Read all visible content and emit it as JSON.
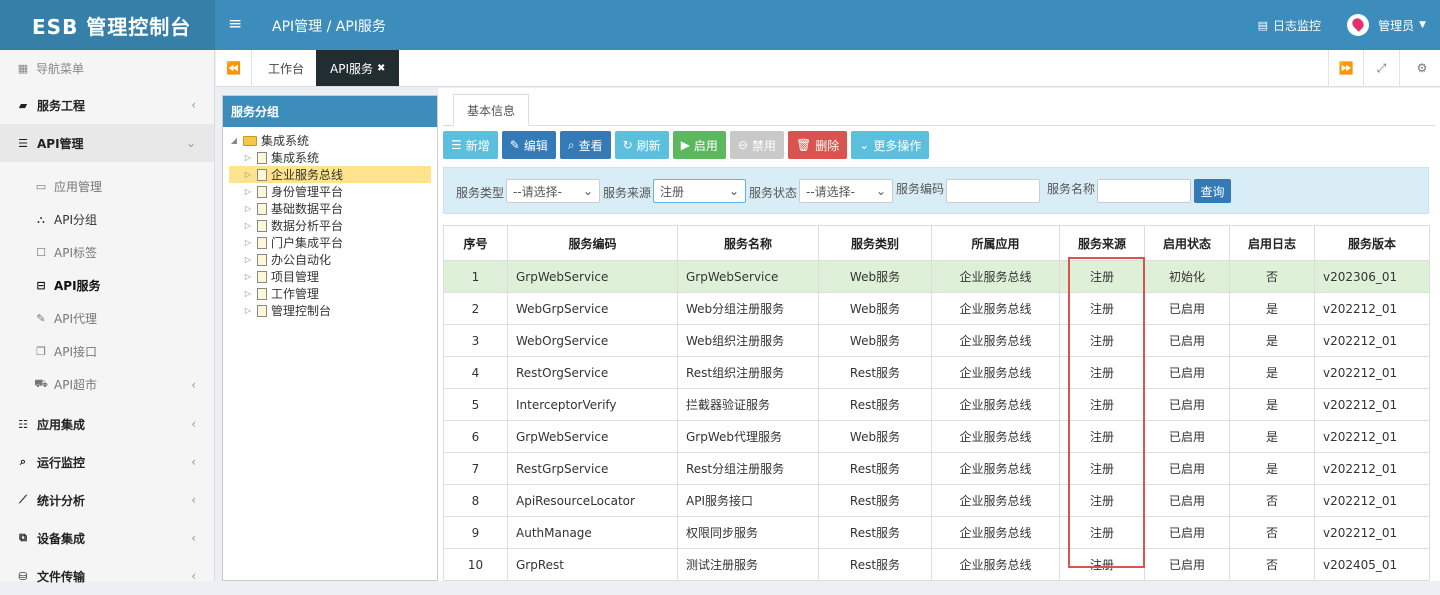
{
  "header": {
    "logo": "ESB 管理控制台",
    "breadcrumb": "API管理 / API服务",
    "log_monitor": "日志监控",
    "user": "管理员"
  },
  "sidebar": {
    "title": "导航菜单",
    "items": [
      {
        "label": "服务工程"
      },
      {
        "label": "API管理"
      }
    ],
    "sub": [
      {
        "label": "应用管理"
      },
      {
        "label": "API分组"
      },
      {
        "label": "API标签"
      },
      {
        "label": "API服务"
      },
      {
        "label": "API代理"
      },
      {
        "label": "API接口"
      },
      {
        "label": "API超市"
      }
    ],
    "items2": [
      {
        "label": "应用集成"
      },
      {
        "label": "运行监控"
      },
      {
        "label": "统计分析"
      },
      {
        "label": "设备集成"
      },
      {
        "label": "文件传输"
      }
    ]
  },
  "tabs": {
    "home": "工作台",
    "active": "API服务"
  },
  "tree": {
    "title": "服务分组",
    "root": "集成系统",
    "children": [
      "集成系统",
      "企业服务总线",
      "身份管理平台",
      "基础数据平台",
      "数据分析平台",
      "门户集成平台",
      "办公自动化",
      "项目管理",
      "工作管理",
      "管理控制台"
    ]
  },
  "main": {
    "tab": "基本信息",
    "buttons": {
      "add": "新增",
      "edit": "编辑",
      "view": "查看",
      "refresh": "刷新",
      "enable": "启用",
      "disable": "禁用",
      "delete": "删除",
      "more": "更多操作"
    },
    "filter": {
      "type_label": "服务类型",
      "type_value": "--请选择-",
      "source_label": "服务来源",
      "source_value": "注册",
      "status_label": "服务状态",
      "status_value": "--请选择-",
      "code_label": "服务编码",
      "name_label": "服务名称",
      "query": "查询"
    },
    "columns": [
      "序号",
      "服务编码",
      "服务名称",
      "服务类别",
      "所属应用",
      "服务来源",
      "启用状态",
      "启用日志",
      "服务版本"
    ],
    "rows": [
      [
        "1",
        "GrpWebService",
        "GrpWebService",
        "Web服务",
        "企业服务总线",
        "注册",
        "初始化",
        "否",
        "v202306_01"
      ],
      [
        "2",
        "WebGrpService",
        "Web分组注册服务",
        "Web服务",
        "企业服务总线",
        "注册",
        "已启用",
        "是",
        "v202212_01"
      ],
      [
        "3",
        "WebOrgService",
        "Web组织注册服务",
        "Web服务",
        "企业服务总线",
        "注册",
        "已启用",
        "是",
        "v202212_01"
      ],
      [
        "4",
        "RestOrgService",
        "Rest组织注册服务",
        "Rest服务",
        "企业服务总线",
        "注册",
        "已启用",
        "是",
        "v202212_01"
      ],
      [
        "5",
        "InterceptorVerify",
        "拦截器验证服务",
        "Rest服务",
        "企业服务总线",
        "注册",
        "已启用",
        "是",
        "v202212_01"
      ],
      [
        "6",
        "GrpWebService",
        "GrpWeb代理服务",
        "Web服务",
        "企业服务总线",
        "注册",
        "已启用",
        "是",
        "v202212_01"
      ],
      [
        "7",
        "RestGrpService",
        "Rest分组注册服务",
        "Rest服务",
        "企业服务总线",
        "注册",
        "已启用",
        "是",
        "v202212_01"
      ],
      [
        "8",
        "ApiResourceLocator",
        "API服务接口",
        "Rest服务",
        "企业服务总线",
        "注册",
        "已启用",
        "否",
        "v202212_01"
      ],
      [
        "9",
        "AuthManage",
        "权限同步服务",
        "Rest服务",
        "企业服务总线",
        "注册",
        "已启用",
        "否",
        "v202212_01"
      ],
      [
        "10",
        "GrpRest",
        "测试注册服务",
        "Rest服务",
        "企业服务总线",
        "注册",
        "已启用",
        "否",
        "v202405_01"
      ]
    ]
  }
}
